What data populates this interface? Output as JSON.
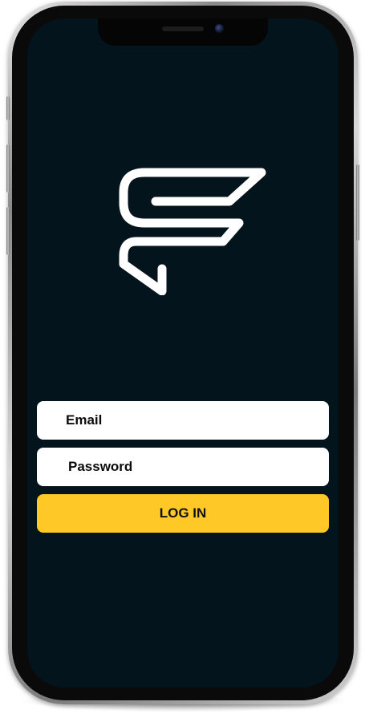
{
  "app": {
    "logo_icon": "stylized-s-bolt-logo-icon"
  },
  "login_form": {
    "email_label": "Email",
    "password_label": "Password",
    "login_button_label": "LOG IN"
  },
  "colors": {
    "screen_background": "#04141c",
    "accent": "#fec926",
    "field_background": "#ffffff",
    "logo": "#ffffff"
  }
}
